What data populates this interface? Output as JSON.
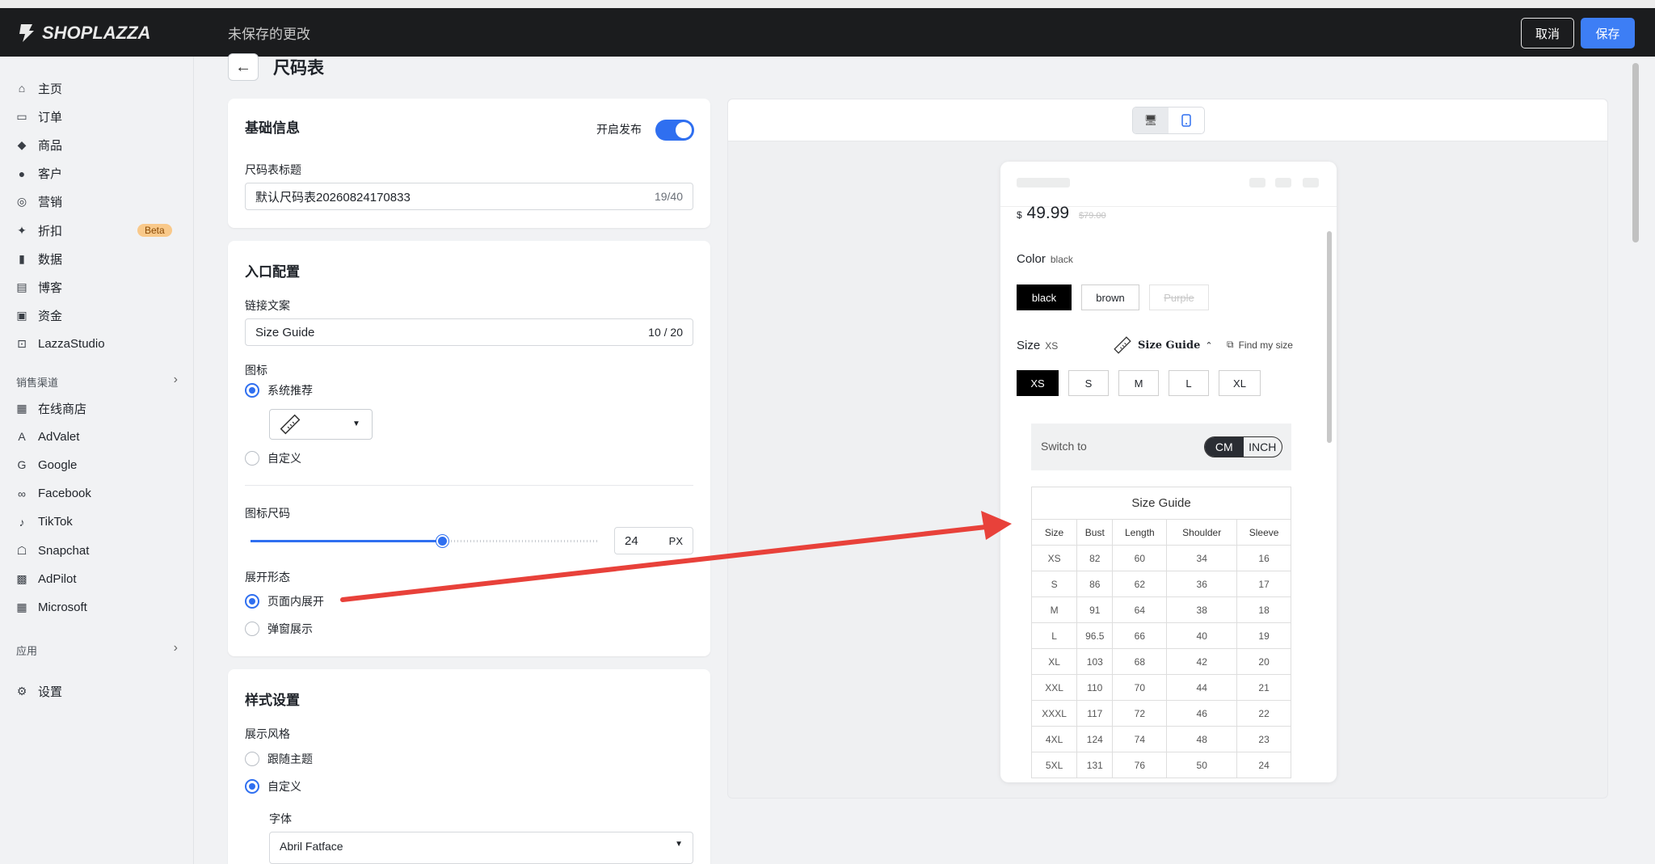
{
  "topbar": {
    "logo": "SHOPLAZZA",
    "status": "未保存的更改",
    "cancel": "取消",
    "save": "保存"
  },
  "sidebar": {
    "items": [
      {
        "label": "主页",
        "icon": "home-icon"
      },
      {
        "label": "订单",
        "icon": "orders-icon"
      },
      {
        "label": "商品",
        "icon": "tag-icon"
      },
      {
        "label": "客户",
        "icon": "user-icon"
      },
      {
        "label": "营销",
        "icon": "marketing-icon"
      },
      {
        "label": "折扣",
        "icon": "discount-icon",
        "badge": "Beta"
      },
      {
        "label": "数据",
        "icon": "chart-icon"
      },
      {
        "label": "博客",
        "icon": "blog-icon"
      },
      {
        "label": "资金",
        "icon": "wallet-icon"
      },
      {
        "label": "LazzaStudio",
        "icon": "studio-icon"
      }
    ],
    "channels_label": "销售渠道",
    "channels": [
      {
        "label": "在线商店",
        "icon": "store-icon"
      },
      {
        "label": "AdValet",
        "icon": "advalet-icon"
      },
      {
        "label": "Google",
        "icon": "google-icon"
      },
      {
        "label": "Facebook",
        "icon": "facebook-icon"
      },
      {
        "label": "TikTok",
        "icon": "tiktok-icon"
      },
      {
        "label": "Snapchat",
        "icon": "snapchat-icon"
      },
      {
        "label": "AdPilot",
        "icon": "adpilot-icon"
      },
      {
        "label": "Microsoft",
        "icon": "microsoft-icon"
      }
    ],
    "apps_label": "应用",
    "settings": {
      "label": "设置",
      "icon": "gear-icon"
    }
  },
  "page": {
    "title": "尺码表"
  },
  "basic": {
    "title": "基础信息",
    "publish_label": "开启发布",
    "publish_on": true,
    "name_label": "尺码表标题",
    "name_value": "默认尺码表20260824170833",
    "name_count": "19/40"
  },
  "entry": {
    "title": "入口配置",
    "link_label": "链接文案",
    "link_value": "Size Guide",
    "link_count": "10 / 20",
    "icon_label": "图标",
    "icon_option_default": "系统推荐",
    "icon_option_custom": "自定义",
    "icon_size_label": "图标尺码",
    "icon_size_value": "24",
    "icon_size_unit": "PX",
    "icon_size_fraction": 0.55,
    "expand_label": "展开形态",
    "expand_inline": "页面内展开",
    "expand_popup": "弹窗展示"
  },
  "style": {
    "title": "样式设置",
    "display_label": "展示风格",
    "follow_theme": "跟随主题",
    "custom": "自定义",
    "font_label": "字体",
    "font_value": "Abril Fatface"
  },
  "preview": {
    "price_symbol": "$",
    "price": "49.99",
    "old_price": "$79.00",
    "color_label": "Color",
    "color_value": "black",
    "colors": [
      "black",
      "brown",
      "Purple"
    ],
    "size_label": "Size",
    "size_value": "XS",
    "size_guide_link": "Size Guide",
    "find_size": "Find my size",
    "sizes": [
      "XS",
      "S",
      "M",
      "L",
      "XL"
    ],
    "switch_label": "Switch to",
    "units": [
      "CM",
      "INCH"
    ],
    "table_title": "Size Guide",
    "table_headers": [
      "Size",
      "Bust",
      "Length",
      "Shoulder",
      "Sleeve"
    ],
    "table_rows": [
      [
        "XS",
        "82",
        "60",
        "34",
        "16"
      ],
      [
        "S",
        "86",
        "62",
        "36",
        "17"
      ],
      [
        "M",
        "91",
        "64",
        "38",
        "18"
      ],
      [
        "L",
        "96.5",
        "66",
        "40",
        "19"
      ],
      [
        "XL",
        "103",
        "68",
        "42",
        "20"
      ],
      [
        "XXL",
        "110",
        "70",
        "44",
        "21"
      ],
      [
        "XXXL",
        "117",
        "72",
        "46",
        "22"
      ],
      [
        "4XL",
        "124",
        "74",
        "48",
        "23"
      ],
      [
        "5XL",
        "131",
        "76",
        "50",
        "24"
      ]
    ]
  },
  "colors": {
    "accent": "#2f6ff0",
    "topbar": "#1b1c1e",
    "annotation_arrow": "#e8413a"
  }
}
